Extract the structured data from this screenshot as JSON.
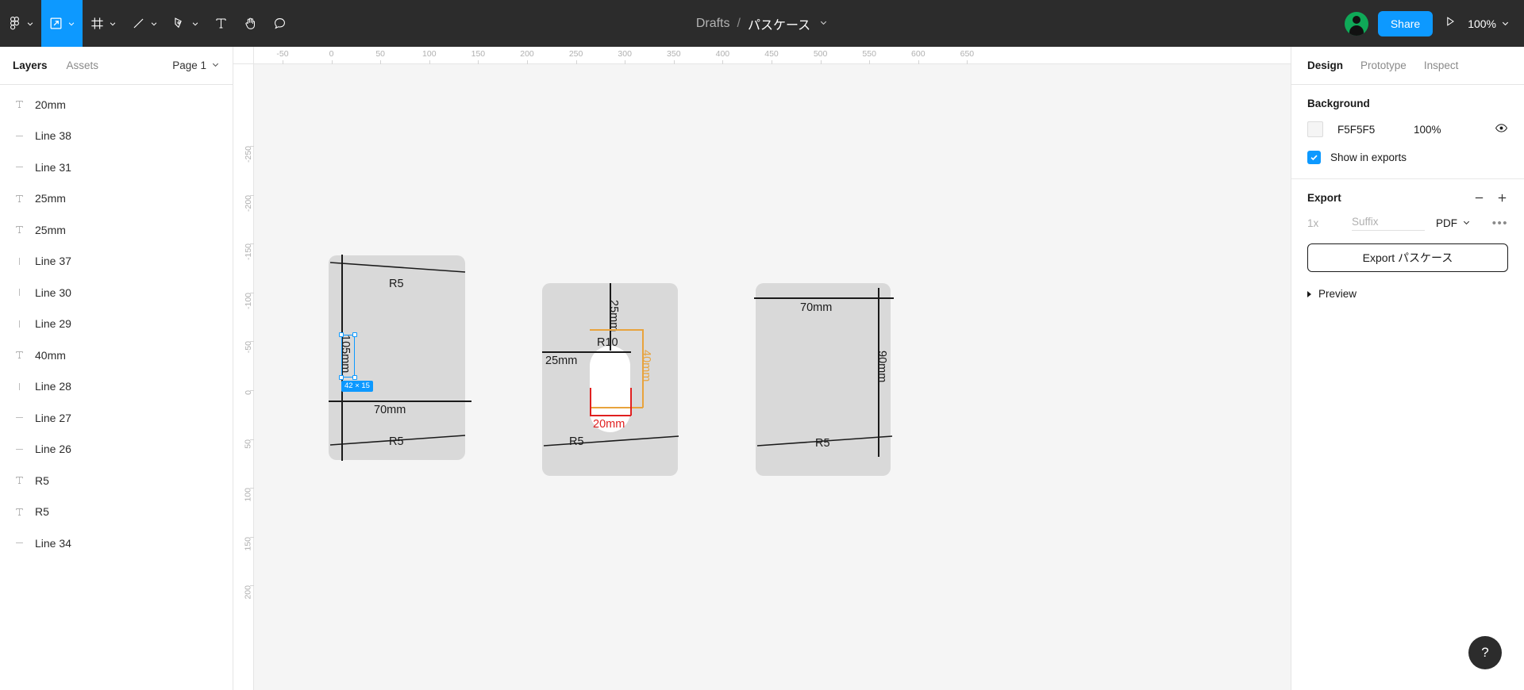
{
  "toolbar": {
    "tools": [
      {
        "name": "figma-menu-icon",
        "label": "Menu",
        "caret": true,
        "active": false
      },
      {
        "name": "move-tool-icon",
        "label": "Move",
        "caret": true,
        "active": true
      },
      {
        "name": "frame-tool-icon",
        "label": "Frame",
        "caret": true,
        "active": false
      },
      {
        "name": "shape-tool-icon",
        "label": "Line",
        "caret": true,
        "active": false
      },
      {
        "name": "pen-tool-icon",
        "label": "Pen",
        "caret": true,
        "active": false
      },
      {
        "name": "text-tool-icon",
        "label": "Text",
        "caret": false,
        "active": false
      },
      {
        "name": "hand-tool-icon",
        "label": "Hand",
        "caret": false,
        "active": false
      },
      {
        "name": "comment-tool-icon",
        "label": "Comment",
        "caret": false,
        "active": false
      }
    ]
  },
  "header": {
    "breadcrumb_project": "Drafts",
    "breadcrumb_separator": "/",
    "file_name": "パスケース",
    "share_label": "Share",
    "zoom_level": "100%",
    "present_icon": "play-icon",
    "avatar_icon": "user-avatar"
  },
  "left_panel": {
    "tabs": [
      {
        "label": "Layers",
        "active": true
      },
      {
        "label": "Assets",
        "active": false
      }
    ],
    "page_selector": "Page 1",
    "layers": [
      {
        "name": "20mm",
        "type": "text"
      },
      {
        "name": "Line 38",
        "type": "line-h"
      },
      {
        "name": "Line 31",
        "type": "line-h"
      },
      {
        "name": "25mm",
        "type": "text"
      },
      {
        "name": "25mm",
        "type": "text"
      },
      {
        "name": "Line 37",
        "type": "line-v"
      },
      {
        "name": "Line 30",
        "type": "line-v"
      },
      {
        "name": "Line 29",
        "type": "line-v"
      },
      {
        "name": "40mm",
        "type": "text"
      },
      {
        "name": "Line 28",
        "type": "line-v"
      },
      {
        "name": "Line 27",
        "type": "line-h"
      },
      {
        "name": "Line 26",
        "type": "line-h"
      },
      {
        "name": "R5",
        "type": "text"
      },
      {
        "name": "R5",
        "type": "text"
      },
      {
        "name": "Line 34",
        "type": "line-h"
      }
    ]
  },
  "right_panel": {
    "tabs": [
      {
        "label": "Design",
        "active": true
      },
      {
        "label": "Prototype",
        "active": false
      },
      {
        "label": "Inspect",
        "active": false
      }
    ],
    "background": {
      "title": "Background",
      "color_hex": "F5F5F5",
      "opacity": "100%",
      "swatch_color": "#f5f5f5",
      "visibility_icon": "eye-icon",
      "show_in_exports_label": "Show in exports",
      "show_in_exports_checked": true
    },
    "export": {
      "title": "Export",
      "remove_icon": "minus-icon",
      "add_icon": "plus-icon",
      "scale": "1x",
      "suffix_placeholder": "Suffix",
      "format": "PDF",
      "more_icon": "ellipsis-icon",
      "export_button_label": "Export パスケース",
      "preview_label": "Preview"
    }
  },
  "canvas": {
    "ruler_h_ticks": [
      "-50",
      "0",
      "50",
      "100",
      "150",
      "200",
      "250",
      "300",
      "350",
      "400",
      "450",
      "500",
      "550",
      "600",
      "650"
    ],
    "ruler_v_ticks": [
      "-250",
      "-200",
      "-150",
      "-100",
      "-50",
      "0",
      "50",
      "100",
      "150",
      "200"
    ],
    "selection_badge": "42 × 15",
    "cards": [
      {
        "id": "card-left",
        "labels": [
          {
            "text": "R5",
            "name": "corner-radius-label-top-left",
            "color": "#1a1a1a"
          },
          {
            "text": "105mm",
            "name": "height-dimension-label",
            "color": "#1a1a1a",
            "selected": true
          },
          {
            "text": "70mm",
            "name": "width-dimension-label",
            "color": "#1a1a1a"
          },
          {
            "text": "R5",
            "name": "corner-radius-label-bottom-left",
            "color": "#1a1a1a"
          }
        ]
      },
      {
        "id": "card-middle",
        "labels": [
          {
            "text": "25mm",
            "name": "slot-top-offset-label",
            "color": "#1a1a1a"
          },
          {
            "text": "25mm",
            "name": "slot-left-offset-label",
            "color": "#1a1a1a"
          },
          {
            "text": "R10",
            "name": "slot-radius-label",
            "color": "#1a1a1a"
          },
          {
            "text": "40mm",
            "name": "slot-height-label",
            "color": "#e8a33d"
          },
          {
            "text": "20mm",
            "name": "slot-width-label",
            "color": "#e02020"
          },
          {
            "text": "R5",
            "name": "corner-radius-label-bottom",
            "color": "#1a1a1a"
          }
        ]
      },
      {
        "id": "card-right",
        "labels": [
          {
            "text": "70mm",
            "name": "width-dimension-label",
            "color": "#1a1a1a"
          },
          {
            "text": "90mm",
            "name": "height-dimension-label",
            "color": "#1a1a1a"
          },
          {
            "text": "R5",
            "name": "corner-radius-label-bottom",
            "color": "#1a1a1a"
          }
        ]
      }
    ]
  },
  "help": {
    "label": "?"
  }
}
